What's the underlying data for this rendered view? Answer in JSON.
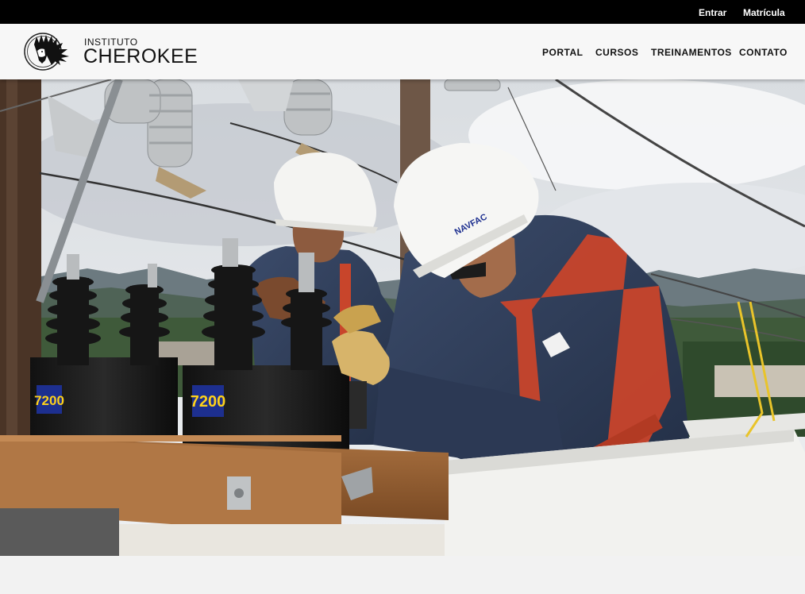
{
  "topbar": {
    "login_label": "Entrar",
    "enroll_label": "Matrícula"
  },
  "brand": {
    "small": "INSTITUTO",
    "big": "CHEROKEE"
  },
  "nav": {
    "items": [
      "PORTAL",
      "CURSOS",
      "TREINAMENTOS",
      "CONTATO"
    ]
  },
  "hero": {
    "transformer_label_1": "7200",
    "transformer_label_2": "7200",
    "helmet_brand": "NAVFAC"
  }
}
